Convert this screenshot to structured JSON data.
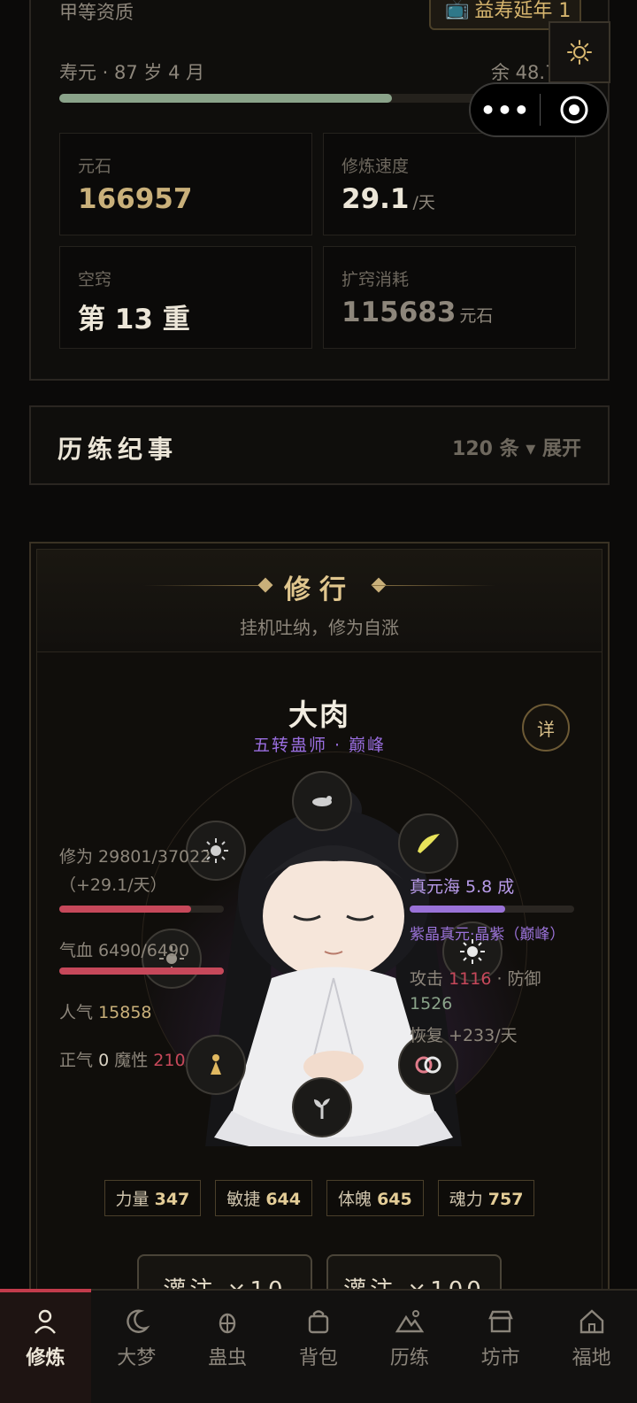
{
  "top": {
    "grade": "甲等资质",
    "ad_button": "益寿延年 1",
    "lifespan_label": "寿元 · 87 岁 4 月",
    "lifespan_remaining": "余 48.7 年",
    "lifespan_progress": 0.64,
    "stats": [
      {
        "label": "元石",
        "value": "166957",
        "unit": ""
      },
      {
        "label": "修炼速度",
        "value": "29.1",
        "unit": "/天"
      },
      {
        "label": "空窍",
        "value": "第 13 重",
        "unit": ""
      },
      {
        "label": "扩窍消耗",
        "value": "115683",
        "unit": "元石"
      }
    ]
  },
  "capsule": {
    "more_icon": "more-dots-icon",
    "close_icon": "target-icon"
  },
  "settings_icon": "sun-gear-icon",
  "history": {
    "title": "历练纪事",
    "count": "120 条 ▾ 展开"
  },
  "cultivation": {
    "title": "修行",
    "subtitle": "挂机吐纳，修为自涨",
    "name": "大肉",
    "rank": "五转蛊师 · 巅峰",
    "detail": "详",
    "cultivation_stat": "修为 29801/37022",
    "cultivation_rate": "（+29.1/天）",
    "cultivation_progress": 0.8,
    "hp_stat": "气血 6490/6490",
    "hp_progress": 1.0,
    "popularity_label": "人气",
    "popularity_value": "15858",
    "righteous_label": "正气",
    "righteous_value": "0",
    "demonic_label": "魔性",
    "demonic_value": "210",
    "sea_stat": "真元海 5.8 成",
    "sea_progress": 0.58,
    "essence": "紫晶真元·晶紫（巅峰）",
    "attack_label": "攻击",
    "attack_value": "1116",
    "defense_label": "· 防御",
    "defense_value": "1526",
    "recover": "恢复 +233/天",
    "attrs": [
      {
        "label": "力量",
        "value": "347"
      },
      {
        "label": "敏捷",
        "value": "644"
      },
      {
        "label": "体魄",
        "value": "645"
      },
      {
        "label": "魂力",
        "value": "757"
      }
    ],
    "buttons": [
      "灌注 ×10",
      "灌注 ×100"
    ]
  },
  "tabs": [
    "修炼",
    "大梦",
    "蛊虫",
    "背包",
    "历练",
    "坊市",
    "福地"
  ],
  "colors": {
    "accent": "#c23b4b",
    "gold": "#c9b07a",
    "purple": "#9a72d8",
    "bar_green": "#8aa38a"
  }
}
